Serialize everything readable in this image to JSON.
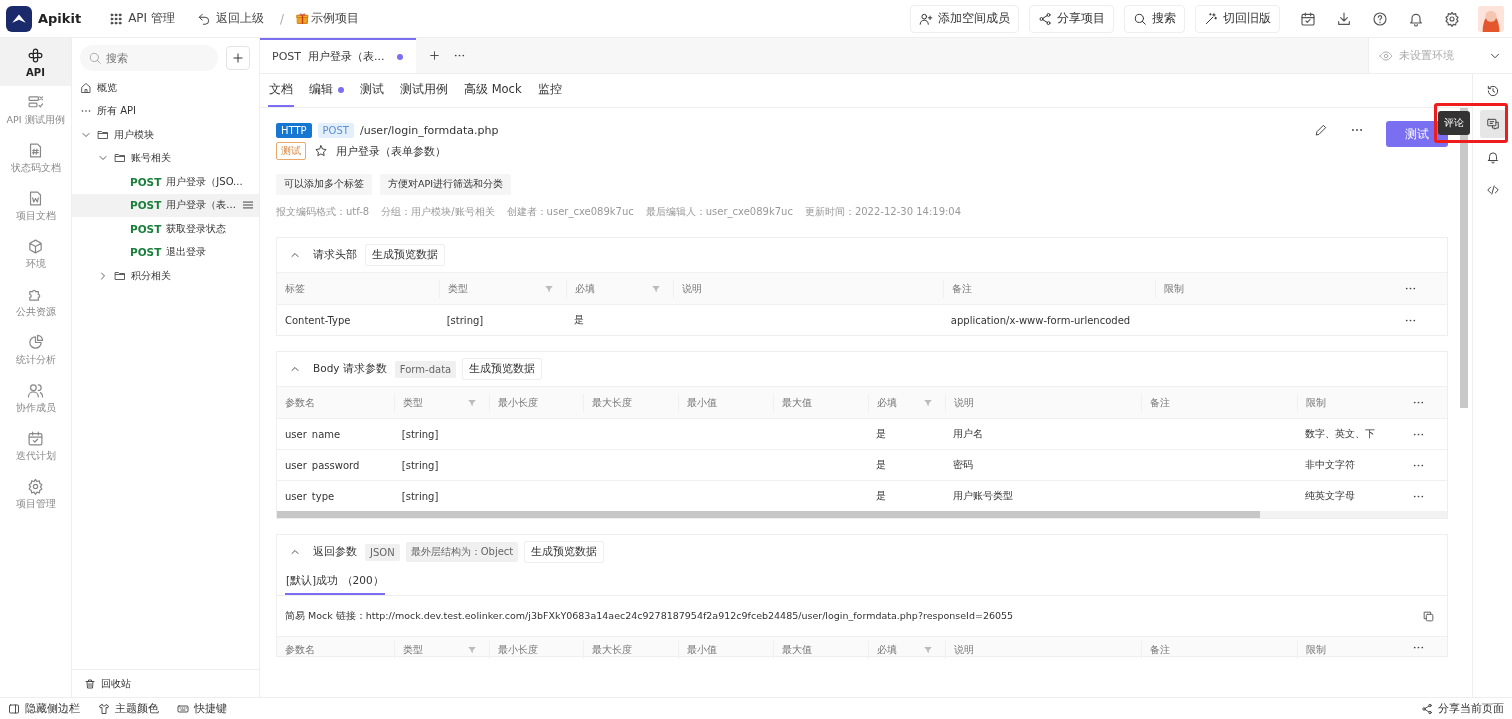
{
  "app": {
    "name": "Apikit"
  },
  "top_nav": [
    {
      "label": "API 管理"
    },
    {
      "label": "返回上级"
    }
  ],
  "breadcrumb": {
    "separator": "/",
    "project": "示例项目"
  },
  "top_actions": [
    {
      "label": "添加空间成员"
    },
    {
      "label": "分享项目"
    },
    {
      "label": "搜索"
    },
    {
      "label": "切回旧版"
    }
  ],
  "rail": [
    {
      "label": "API",
      "selected": true
    },
    {
      "label": "API 测试用例",
      "selected": false
    },
    {
      "label": "状态码文档",
      "selected": false
    },
    {
      "label": "项目文档",
      "selected": false
    },
    {
      "label": "环境",
      "selected": false
    },
    {
      "label": "公共资源",
      "selected": false
    },
    {
      "label": "统计分析",
      "selected": false
    },
    {
      "label": "协作成员",
      "selected": false
    },
    {
      "label": "迭代计划",
      "selected": false
    },
    {
      "label": "项目管理",
      "selected": false
    }
  ],
  "tree": {
    "search": {
      "placeholder": "搜索"
    },
    "items": [
      {
        "kind": "home",
        "label": "概览"
      },
      {
        "kind": "all",
        "label": "所有 API"
      },
      {
        "kind": "folder",
        "label": "用户模块",
        "expanded": true,
        "children": [
          {
            "kind": "folder",
            "label": "账号相关",
            "expanded": true,
            "children": [
              {
                "kind": "api",
                "method": "POST",
                "label": "用户登录（JSO...",
                "selected": false
              },
              {
                "kind": "api",
                "method": "POST",
                "label": "用户登录（表...",
                "selected": true
              },
              {
                "kind": "api",
                "method": "POST",
                "label": "获取登录状态",
                "selected": false
              },
              {
                "kind": "api",
                "method": "POST",
                "label": "退出登录",
                "selected": false
              }
            ]
          },
          {
            "kind": "folder",
            "label": "积分相关",
            "expanded": false
          }
        ]
      }
    ],
    "trash": "回收站"
  },
  "open_tabs": [
    {
      "method": "POST",
      "label": "用户登录（表...",
      "modified": true,
      "selected": true
    }
  ],
  "environment": {
    "placeholder": "未设置环境"
  },
  "doc_tabs": [
    {
      "label": "文档",
      "selected": true,
      "modified": false
    },
    {
      "label": "编辑",
      "selected": false,
      "modified": true
    },
    {
      "label": "测试",
      "selected": false,
      "modified": false
    },
    {
      "label": "测试用例",
      "selected": false,
      "modified": false
    },
    {
      "label": "高级 Mock",
      "selected": false,
      "modified": false
    },
    {
      "label": "监控",
      "selected": false,
      "modified": false
    }
  ],
  "api": {
    "protocol": "HTTP",
    "method": "POST",
    "path": "/user/login_formdata.php",
    "status": "测试",
    "starred": false,
    "name": "用户登录（表单参数）",
    "run_button": "测试",
    "tags": [
      "可以添加多个标签",
      "方便对API进行筛选和分类"
    ],
    "meta": [
      "报文编码格式：utf-8",
      "分组：用户模块/账号相关",
      "创建者：user_cxe089k7uc",
      "最后编辑人：user_cxe089k7uc",
      "更新时间：2022-12-30 14:19:04"
    ]
  },
  "sections": [
    {
      "title": "请求头部",
      "expanded": true,
      "action": "生成预览数据",
      "columns": [
        {
          "label": "标签",
          "filter": false
        },
        {
          "label": "类型",
          "filter": true
        },
        {
          "label": "必填",
          "filter": true
        },
        {
          "label": "说明",
          "filter": false
        },
        {
          "label": "备注",
          "filter": false
        },
        {
          "label": "限制",
          "filter": false
        }
      ],
      "rows": [
        {
          "cells": [
            "Content-Type",
            "[string]",
            "是",
            null,
            "application/x-www-form-urlencoded",
            null
          ]
        }
      ]
    },
    {
      "title": "Body 请求参数",
      "expanded": true,
      "badges": [
        "Form-data"
      ],
      "action": "生成预览数据",
      "columns": [
        {
          "label": "参数名",
          "filter": false
        },
        {
          "label": "类型",
          "filter": true
        },
        {
          "label": "最小长度",
          "filter": false
        },
        {
          "label": "最大长度",
          "filter": false
        },
        {
          "label": "最小值",
          "filter": false
        },
        {
          "label": "最大值",
          "filter": false
        },
        {
          "label": "必填",
          "filter": true
        },
        {
          "label": "说明",
          "filter": false
        },
        {
          "label": "备注",
          "filter": false
        },
        {
          "label": "限制",
          "filter": false
        }
      ],
      "rows": [
        {
          "cells": [
            "user_name",
            "[string]",
            null,
            null,
            null,
            null,
            "是",
            "用户名",
            null,
            "数字、英文、下"
          ]
        },
        {
          "cells": [
            "user_password",
            "[string]",
            null,
            null,
            null,
            null,
            "是",
            "密码",
            null,
            "非中文字符"
          ]
        },
        {
          "cells": [
            "user_type",
            "[string]",
            null,
            null,
            null,
            null,
            "是",
            "用户账号类型",
            null,
            "纯英文字母"
          ]
        }
      ]
    },
    {
      "title": "返回参数",
      "expanded": true,
      "badges": [
        "JSON",
        "最外层结构为：Object"
      ],
      "action": "生成预览数据",
      "responses": [
        {
          "label": "[默认]成功 （200）",
          "selected": true
        }
      ],
      "mock_link": "简易 Mock 链接：http://mock.dev.test.eolinker.com/j3bFXkY0683a14aec24c9278187954f2a912c9fceb24485/user/login_formdata.php?responseId=26055",
      "columns": [
        {
          "label": "参数名",
          "filter": false
        },
        {
          "label": "类型",
          "filter": true
        },
        {
          "label": "最小长度",
          "filter": false
        },
        {
          "label": "最大长度",
          "filter": false
        },
        {
          "label": "最小值",
          "filter": false
        },
        {
          "label": "最大值",
          "filter": false
        },
        {
          "label": "必填",
          "filter": true
        },
        {
          "label": "说明",
          "filter": false
        },
        {
          "label": "备注",
          "filter": false
        },
        {
          "label": "限制",
          "filter": false
        }
      ]
    }
  ],
  "right_rail": [
    {
      "selected": false
    },
    {
      "selected": true
    },
    {
      "selected": false
    },
    {
      "selected": false
    }
  ],
  "tooltip": "评论",
  "footer": {
    "left": [
      "隐藏侧边栏",
      "主题颜色",
      "快捷键"
    ],
    "right": "分享当前页面"
  }
}
